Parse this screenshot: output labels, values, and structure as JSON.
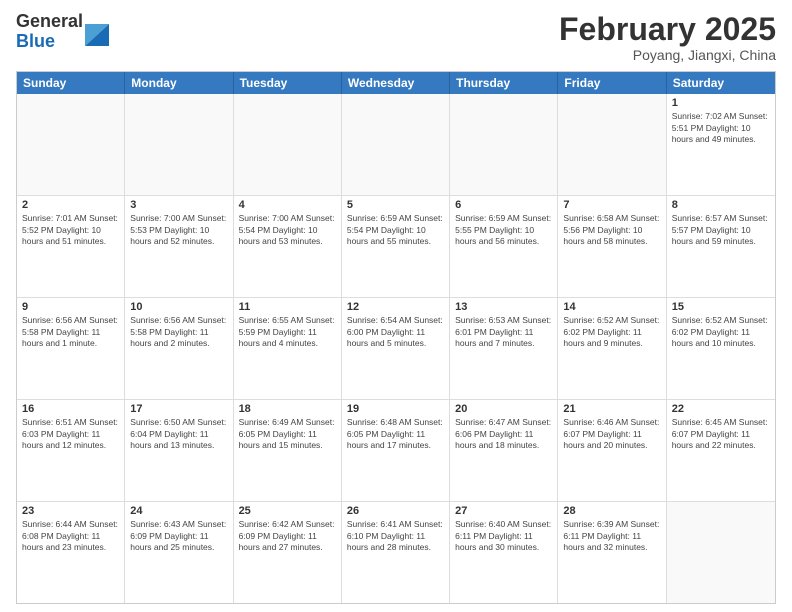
{
  "header": {
    "logo": {
      "line1": "General",
      "line2": "Blue"
    },
    "title": "February 2025",
    "location": "Poyang, Jiangxi, China"
  },
  "calendar": {
    "days": [
      "Sunday",
      "Monday",
      "Tuesday",
      "Wednesday",
      "Thursday",
      "Friday",
      "Saturday"
    ],
    "rows": [
      [
        {
          "day": "",
          "info": ""
        },
        {
          "day": "",
          "info": ""
        },
        {
          "day": "",
          "info": ""
        },
        {
          "day": "",
          "info": ""
        },
        {
          "day": "",
          "info": ""
        },
        {
          "day": "",
          "info": ""
        },
        {
          "day": "1",
          "info": "Sunrise: 7:02 AM\nSunset: 5:51 PM\nDaylight: 10 hours and 49 minutes."
        }
      ],
      [
        {
          "day": "2",
          "info": "Sunrise: 7:01 AM\nSunset: 5:52 PM\nDaylight: 10 hours and 51 minutes."
        },
        {
          "day": "3",
          "info": "Sunrise: 7:00 AM\nSunset: 5:53 PM\nDaylight: 10 hours and 52 minutes."
        },
        {
          "day": "4",
          "info": "Sunrise: 7:00 AM\nSunset: 5:54 PM\nDaylight: 10 hours and 53 minutes."
        },
        {
          "day": "5",
          "info": "Sunrise: 6:59 AM\nSunset: 5:54 PM\nDaylight: 10 hours and 55 minutes."
        },
        {
          "day": "6",
          "info": "Sunrise: 6:59 AM\nSunset: 5:55 PM\nDaylight: 10 hours and 56 minutes."
        },
        {
          "day": "7",
          "info": "Sunrise: 6:58 AM\nSunset: 5:56 PM\nDaylight: 10 hours and 58 minutes."
        },
        {
          "day": "8",
          "info": "Sunrise: 6:57 AM\nSunset: 5:57 PM\nDaylight: 10 hours and 59 minutes."
        }
      ],
      [
        {
          "day": "9",
          "info": "Sunrise: 6:56 AM\nSunset: 5:58 PM\nDaylight: 11 hours and 1 minute."
        },
        {
          "day": "10",
          "info": "Sunrise: 6:56 AM\nSunset: 5:58 PM\nDaylight: 11 hours and 2 minutes."
        },
        {
          "day": "11",
          "info": "Sunrise: 6:55 AM\nSunset: 5:59 PM\nDaylight: 11 hours and 4 minutes."
        },
        {
          "day": "12",
          "info": "Sunrise: 6:54 AM\nSunset: 6:00 PM\nDaylight: 11 hours and 5 minutes."
        },
        {
          "day": "13",
          "info": "Sunrise: 6:53 AM\nSunset: 6:01 PM\nDaylight: 11 hours and 7 minutes."
        },
        {
          "day": "14",
          "info": "Sunrise: 6:52 AM\nSunset: 6:02 PM\nDaylight: 11 hours and 9 minutes."
        },
        {
          "day": "15",
          "info": "Sunrise: 6:52 AM\nSunset: 6:02 PM\nDaylight: 11 hours and 10 minutes."
        }
      ],
      [
        {
          "day": "16",
          "info": "Sunrise: 6:51 AM\nSunset: 6:03 PM\nDaylight: 11 hours and 12 minutes."
        },
        {
          "day": "17",
          "info": "Sunrise: 6:50 AM\nSunset: 6:04 PM\nDaylight: 11 hours and 13 minutes."
        },
        {
          "day": "18",
          "info": "Sunrise: 6:49 AM\nSunset: 6:05 PM\nDaylight: 11 hours and 15 minutes."
        },
        {
          "day": "19",
          "info": "Sunrise: 6:48 AM\nSunset: 6:05 PM\nDaylight: 11 hours and 17 minutes."
        },
        {
          "day": "20",
          "info": "Sunrise: 6:47 AM\nSunset: 6:06 PM\nDaylight: 11 hours and 18 minutes."
        },
        {
          "day": "21",
          "info": "Sunrise: 6:46 AM\nSunset: 6:07 PM\nDaylight: 11 hours and 20 minutes."
        },
        {
          "day": "22",
          "info": "Sunrise: 6:45 AM\nSunset: 6:07 PM\nDaylight: 11 hours and 22 minutes."
        }
      ],
      [
        {
          "day": "23",
          "info": "Sunrise: 6:44 AM\nSunset: 6:08 PM\nDaylight: 11 hours and 23 minutes."
        },
        {
          "day": "24",
          "info": "Sunrise: 6:43 AM\nSunset: 6:09 PM\nDaylight: 11 hours and 25 minutes."
        },
        {
          "day": "25",
          "info": "Sunrise: 6:42 AM\nSunset: 6:09 PM\nDaylight: 11 hours and 27 minutes."
        },
        {
          "day": "26",
          "info": "Sunrise: 6:41 AM\nSunset: 6:10 PM\nDaylight: 11 hours and 28 minutes."
        },
        {
          "day": "27",
          "info": "Sunrise: 6:40 AM\nSunset: 6:11 PM\nDaylight: 11 hours and 30 minutes."
        },
        {
          "day": "28",
          "info": "Sunrise: 6:39 AM\nSunset: 6:11 PM\nDaylight: 11 hours and 32 minutes."
        },
        {
          "day": "",
          "info": ""
        }
      ]
    ]
  }
}
